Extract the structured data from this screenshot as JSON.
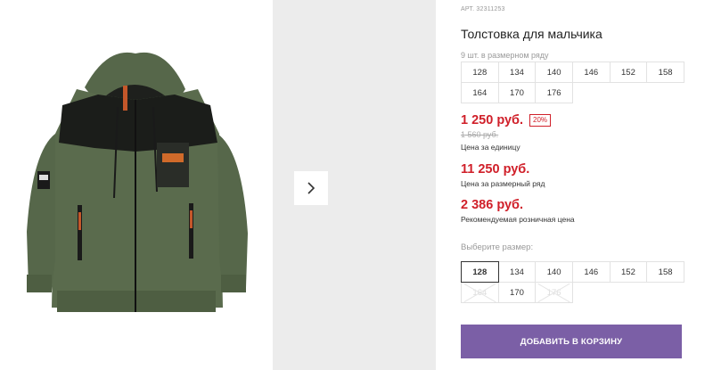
{
  "product": {
    "sku": "АРТ. 32311253",
    "title": "Толстовка для мальчика",
    "image_alt": "jacket-photo",
    "image_patch_text": "MOTO TRIX"
  },
  "pack": {
    "label": "9 шт. в размерном ряду",
    "sizes": [
      "128",
      "134",
      "140",
      "146",
      "152",
      "158",
      "164",
      "170",
      "176"
    ]
  },
  "pricing": {
    "price": "1 250 руб.",
    "discount": "20%",
    "old_price": "1 560 руб.",
    "unit_label": "Цена за единицу",
    "series_price": "11 250 руб.",
    "series_label": "Цена за размерный ряд",
    "rrp_price": "2 386 руб.",
    "rrp_label": "Рекомендуемая розничная цена"
  },
  "size_select": {
    "label": "Выберите размер:",
    "selected": "128",
    "sizes": [
      {
        "label": "128",
        "state": "selected"
      },
      {
        "label": "134",
        "state": "available"
      },
      {
        "label": "140",
        "state": "available"
      },
      {
        "label": "146",
        "state": "available"
      },
      {
        "label": "152",
        "state": "available"
      },
      {
        "label": "158",
        "state": "available"
      },
      {
        "label": "164",
        "state": "disabled"
      },
      {
        "label": "170",
        "state": "available"
      },
      {
        "label": "176",
        "state": "disabled"
      }
    ]
  },
  "actions": {
    "add_to_cart": "ДОБАВИТЬ В КОРЗИНУ",
    "next_image_icon": "chevron-right-icon"
  },
  "colors": {
    "price_red": "#d0202a",
    "button_purple": "#7b5fa6",
    "jacket_green": "#5a6b4d",
    "jacket_black": "#1b1d1a"
  }
}
